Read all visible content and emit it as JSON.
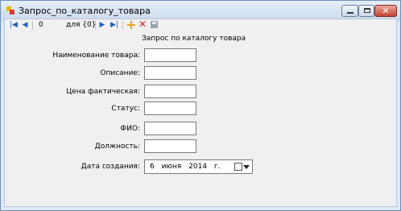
{
  "window": {
    "title": "Запрос_по_каталогу_товара"
  },
  "toolbar": {
    "position_value": "0",
    "count_text": "для {0}",
    "icons": [
      "move-first-icon",
      "move-previous-icon",
      "move-next-icon",
      "move-last-icon",
      "add-new-icon",
      "delete-icon",
      "save-icon"
    ]
  },
  "form": {
    "title": "Запрос по каталогу товара",
    "fields": [
      {
        "label": "Наименование товара:",
        "value": ""
      },
      {
        "label": "Описание:",
        "value": ""
      },
      {
        "label": "Цена фактическая:",
        "value": ""
      },
      {
        "label": "Статус:",
        "value": ""
      },
      {
        "label": "ФИО:",
        "value": ""
      },
      {
        "label": "Должность:",
        "value": ""
      }
    ],
    "date_label": "Дата создания:",
    "date_value": "6 июня 2014 г."
  }
}
